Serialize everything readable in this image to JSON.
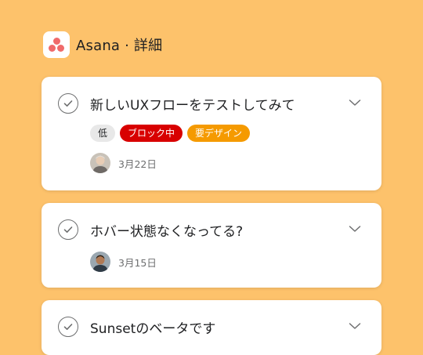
{
  "header": {
    "title": "Asana · 詳細",
    "logo_icon": "asana-logo"
  },
  "colors": {
    "background": "#FDC26B",
    "brand": "#F06A6A",
    "tag_low": "#E8E8E8",
    "tag_blocked": "#D80000",
    "tag_design": "#F59A00"
  },
  "tasks": [
    {
      "title": "新しいUXフローをテストしてみて",
      "tags": [
        {
          "label": "低"
        },
        {
          "label": "ブロック中"
        },
        {
          "label": "要デザイン"
        }
      ],
      "date": "3月22日"
    },
    {
      "title": "ホバー状態なくなってる?",
      "date": "3月15日"
    },
    {
      "title": "Sunsetのベータです"
    }
  ]
}
